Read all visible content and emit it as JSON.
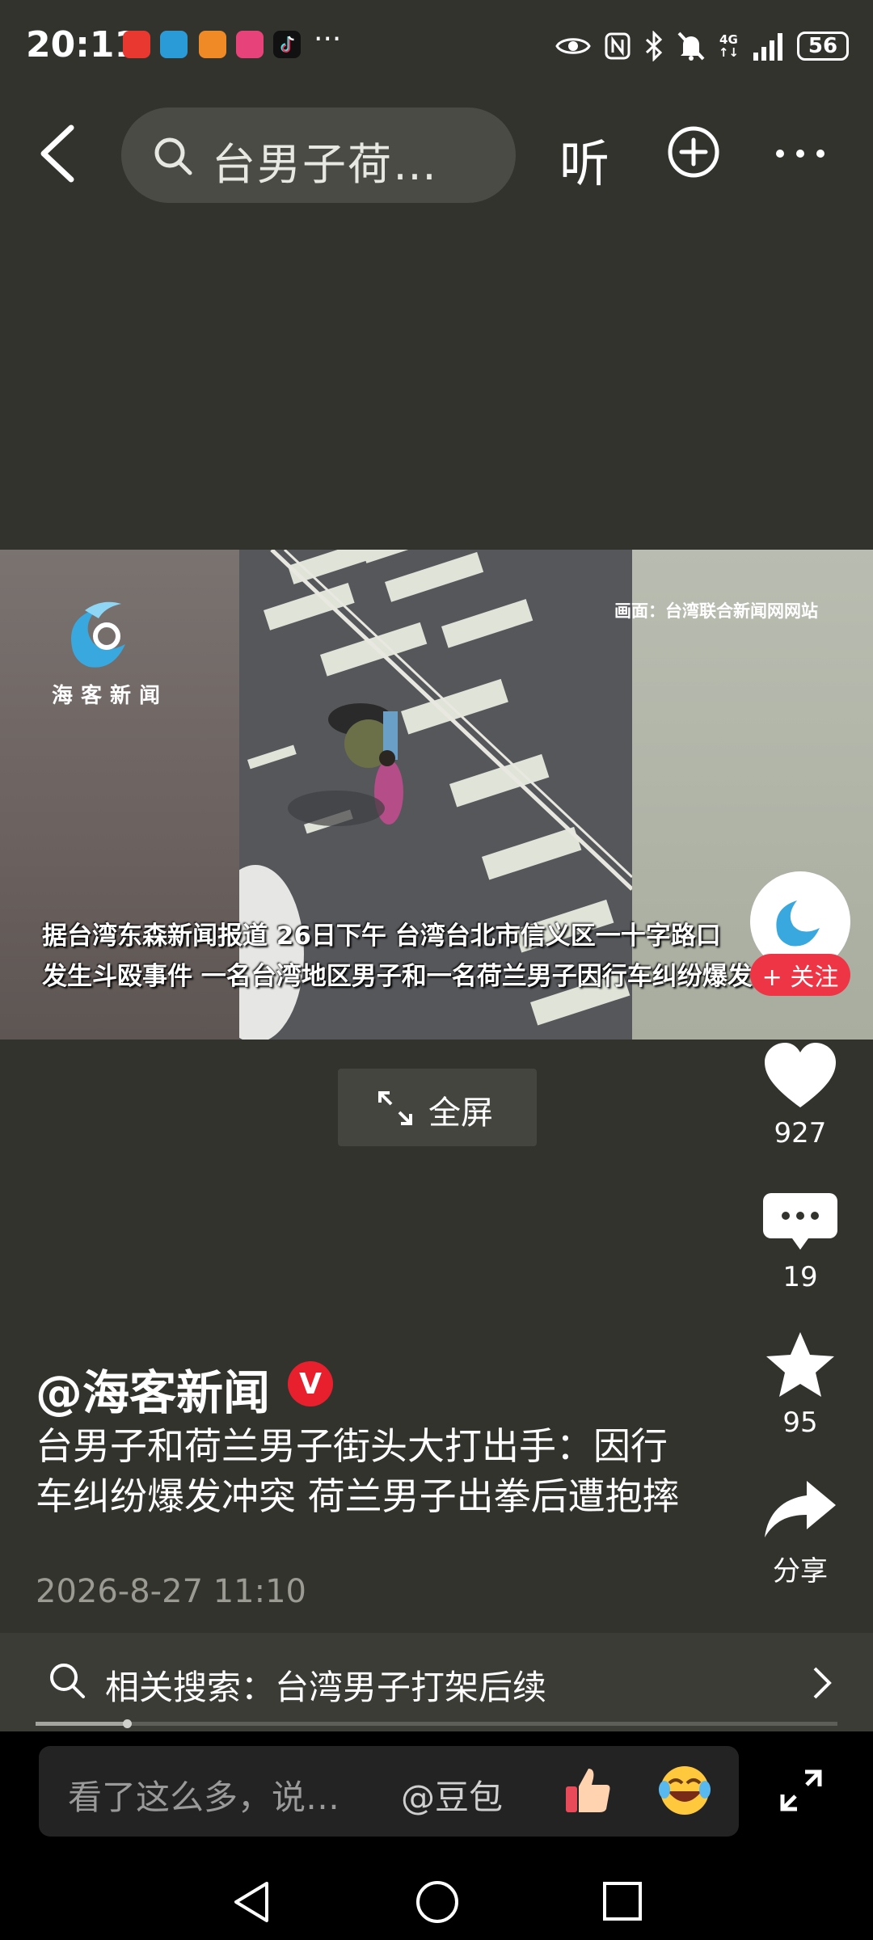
{
  "status_bar": {
    "time": "20:11",
    "dots": "···",
    "network": "4G",
    "battery": "56"
  },
  "top_nav": {
    "search_text": "台男子荷…",
    "listen_label": "听"
  },
  "video": {
    "source_caption": "画面：台湾联合新闻网网站",
    "brand": "海客新闻",
    "subtitle_line1": "据台湾东森新闻报道 26日下午 台湾台北市信义区一十字路口",
    "subtitle_line2": "发生斗殴事件 一名台湾地区男子和一名荷兰男子因行车纠纷爆发"
  },
  "follow_label": "+ 关注",
  "fullscreen_label": "全屏",
  "actions": {
    "likes": "927",
    "comments": "19",
    "favorites": "95",
    "share_label": "分享"
  },
  "post": {
    "author": "@海客新闻",
    "verified_mark": "V",
    "title": "台男子和荷兰男子街头大打出手：因行车纠纷爆发冲突 荷兰男子出拳后遭抱摔",
    "date": "2026-8-27 11:10"
  },
  "related_search": {
    "text": "相关搜索：台湾男子打架后续"
  },
  "playback_progress": 0.114,
  "comment_bar": {
    "placeholder": "看了这么多，说…",
    "at_label": "@豆包"
  },
  "colors": {
    "background": "#33332e",
    "follow": "#ee3545",
    "verified": "#e8202e"
  }
}
